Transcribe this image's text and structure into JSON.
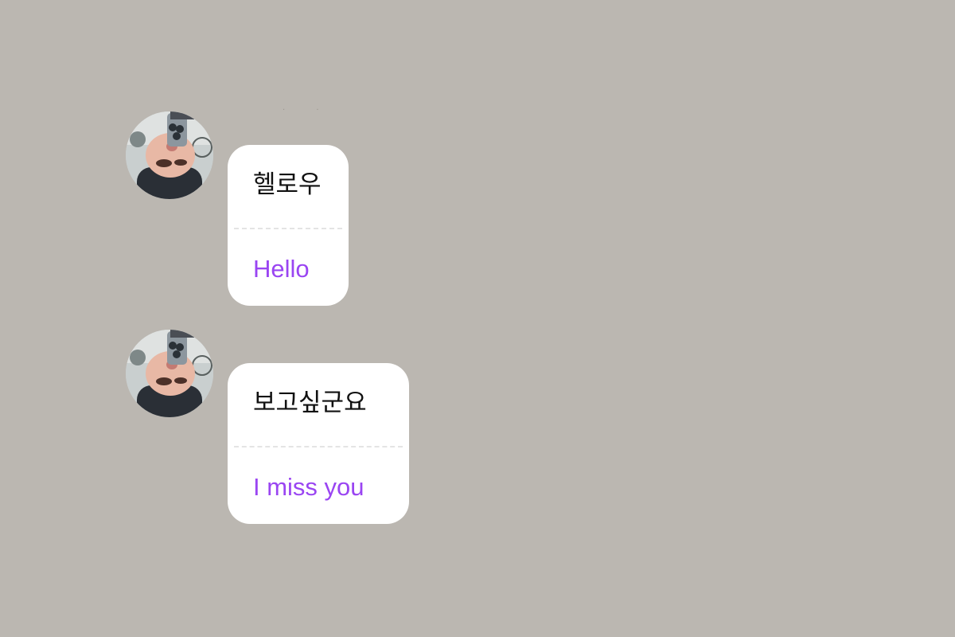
{
  "messages": [
    {
      "original": "헬로우",
      "translation": "Hello"
    },
    {
      "original": "보고싶군요",
      "translation": "I miss you"
    }
  ],
  "colors": {
    "background": "#bbb7b1",
    "bubble": "#ffffff",
    "original_text": "#111111",
    "translation_text": "#9a45f2"
  },
  "icons": {
    "avatar": "profile-photo-avatar"
  }
}
